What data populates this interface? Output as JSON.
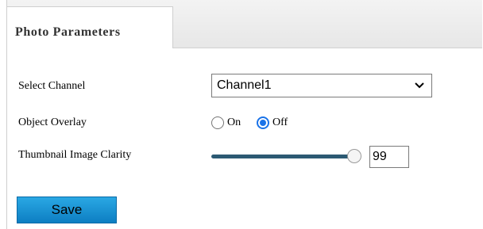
{
  "tab": {
    "label": "Photo Parameters"
  },
  "select_channel": {
    "label": "Select Channel",
    "value": "Channel1"
  },
  "object_overlay": {
    "label": "Object Overlay",
    "options": [
      {
        "label": "On",
        "checked": false
      },
      {
        "label": "Off",
        "checked": true
      }
    ]
  },
  "thumbnail_clarity": {
    "label": "Thumbnail Image Clarity",
    "value": "99",
    "slider_level": 0.99
  },
  "save": {
    "label": "Save"
  },
  "colors": {
    "accent": "#1a73e8",
    "slider_track": "#2c5a73",
    "save_button": "#1893d6"
  },
  "icons": {
    "dropdown": "chevron-down-icon"
  }
}
